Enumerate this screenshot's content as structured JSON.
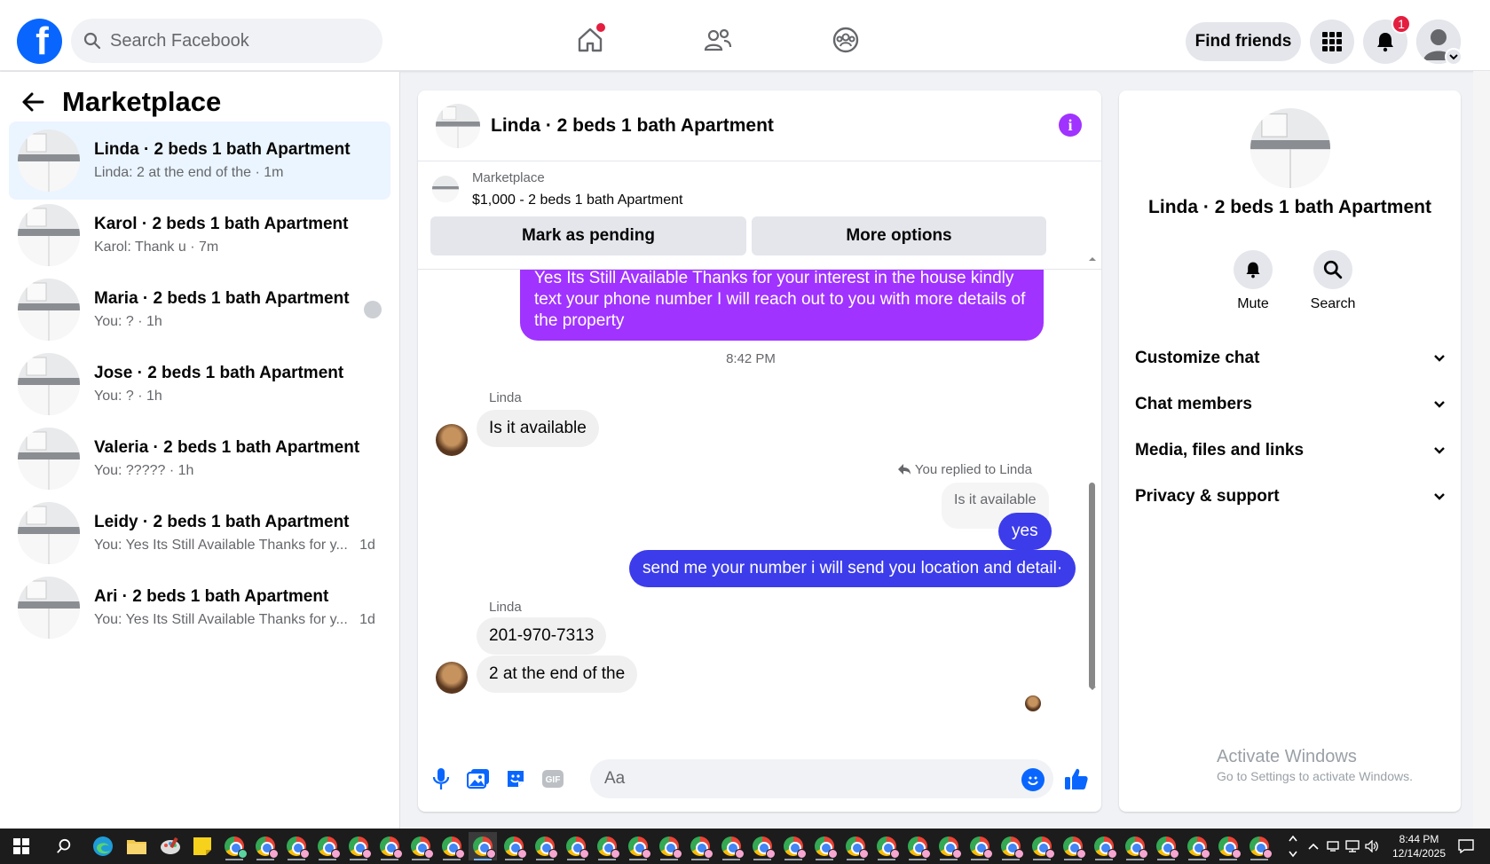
{
  "topnav": {
    "logo_letter": "f",
    "search_placeholder": "Search Facebook",
    "find_friends_label": "Find friends",
    "notification_count": "1"
  },
  "sidebar": {
    "title": "Marketplace",
    "conversations": [
      {
        "name": "Linda · 2 beds 1 bath Apartment",
        "preview": "Linda: 2 at the end of the · 1m",
        "active": true
      },
      {
        "name": "Karol · 2 beds 1 bath Apartment",
        "preview": "Karol: Thank u · 7m"
      },
      {
        "name": "Maria · 2 beds 1 bath Apartment",
        "preview": "You: ? · 1h"
      },
      {
        "name": "Jose · 2 beds 1 bath Apartment",
        "preview": "You: ? · 1h"
      },
      {
        "name": "Valeria · 2 beds 1 bath Apartment",
        "preview": "You: ????? · 1h"
      },
      {
        "name": "Leidy · 2 beds 1 bath Apartment",
        "preview": "You: Yes Its Still Available Thanks for y...",
        "time": "1d"
      },
      {
        "name": "Ari · 2 beds 1 bath Apartment",
        "preview": "You: Yes Its Still Available Thanks for y...",
        "time": "1d"
      }
    ]
  },
  "chat": {
    "title": "Linda · 2 beds 1 bath Apartment",
    "listing_category": "Marketplace",
    "listing_price": "$1,000 - 2 beds 1 bath Apartment",
    "mark_pending_label": "Mark as pending",
    "more_options_label": "More options",
    "messages": {
      "outgoing_long": "Yes Its Still Available Thanks for your interest in the house kindly text your phone number I will reach out to you with more details of the property",
      "timestamp": "8:42 PM",
      "sender_name": "Linda",
      "in_1": "Is it available",
      "replied_note": "You replied to Linda",
      "reply_quote": "Is it available",
      "out_yes": "yes",
      "out_send": "send me your number i will send you location and detail·",
      "in_2": "201-970-7313",
      "in_3": "2 at the end of the"
    },
    "composer_placeholder": "Aa"
  },
  "right_panel": {
    "title": "Linda · 2 beds 1 bath Apartment",
    "mute_label": "Mute",
    "search_label": "Search",
    "sections": [
      "Customize chat",
      "Chat members",
      "Media, files and links",
      "Privacy & support"
    ],
    "watermark_title": "Activate Windows",
    "watermark_sub": "Go to Settings to activate Windows."
  },
  "taskbar": {
    "time": "8:44 PM",
    "date": "12/14/2025"
  },
  "colors": {
    "fb_blue": "#0866ff",
    "purple_bubble": "#a033ff",
    "blue_bubble": "#3c3ceb",
    "badge_red": "#e41e3f"
  }
}
